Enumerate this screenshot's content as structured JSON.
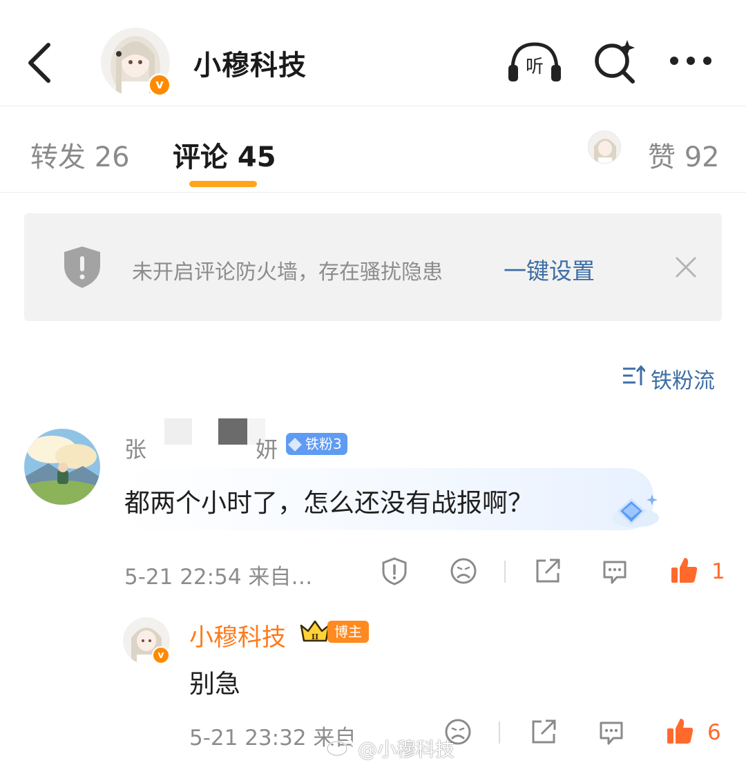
{
  "header": {
    "title": "小穆科技",
    "verified_badge": "v",
    "icons": [
      "back-icon",
      "listen-icon",
      "search-icon",
      "more-icon"
    ],
    "listen_label": "听"
  },
  "tabs": {
    "forward": "转发 26",
    "comment": "评论 45",
    "like": "赞 92",
    "active_color": "#ffa41b"
  },
  "banner": {
    "text": "未开启评论防火墙，存在骚扰隐患",
    "link": "一键设置",
    "link_color": "#3d6ea6"
  },
  "sort": {
    "label": "铁粉流"
  },
  "comment": {
    "name_start": "张",
    "name_end": "妍",
    "fan_badge": "铁粉3",
    "text": "都两个小时了，怎么还没有战报啊？",
    "time": "5-21 22:54  来自…",
    "like_count": "1",
    "actions": [
      "report-icon",
      "dislike-icon",
      "share-icon",
      "reply-icon",
      "like-icon"
    ]
  },
  "reply": {
    "name": "小穆科技",
    "badge": "博主",
    "crown_level": "II",
    "text": "别急",
    "time": "5-21 23:32  来自",
    "like_count": "6",
    "actions": [
      "dislike-icon",
      "share-icon",
      "reply-icon",
      "like-icon"
    ]
  },
  "watermark": {
    "text": "@小穆科技"
  },
  "colors": {
    "accent_orange": "#ff7a1a",
    "link_blue": "#3d6ea6",
    "fan_blue": "#5f9bf3"
  }
}
